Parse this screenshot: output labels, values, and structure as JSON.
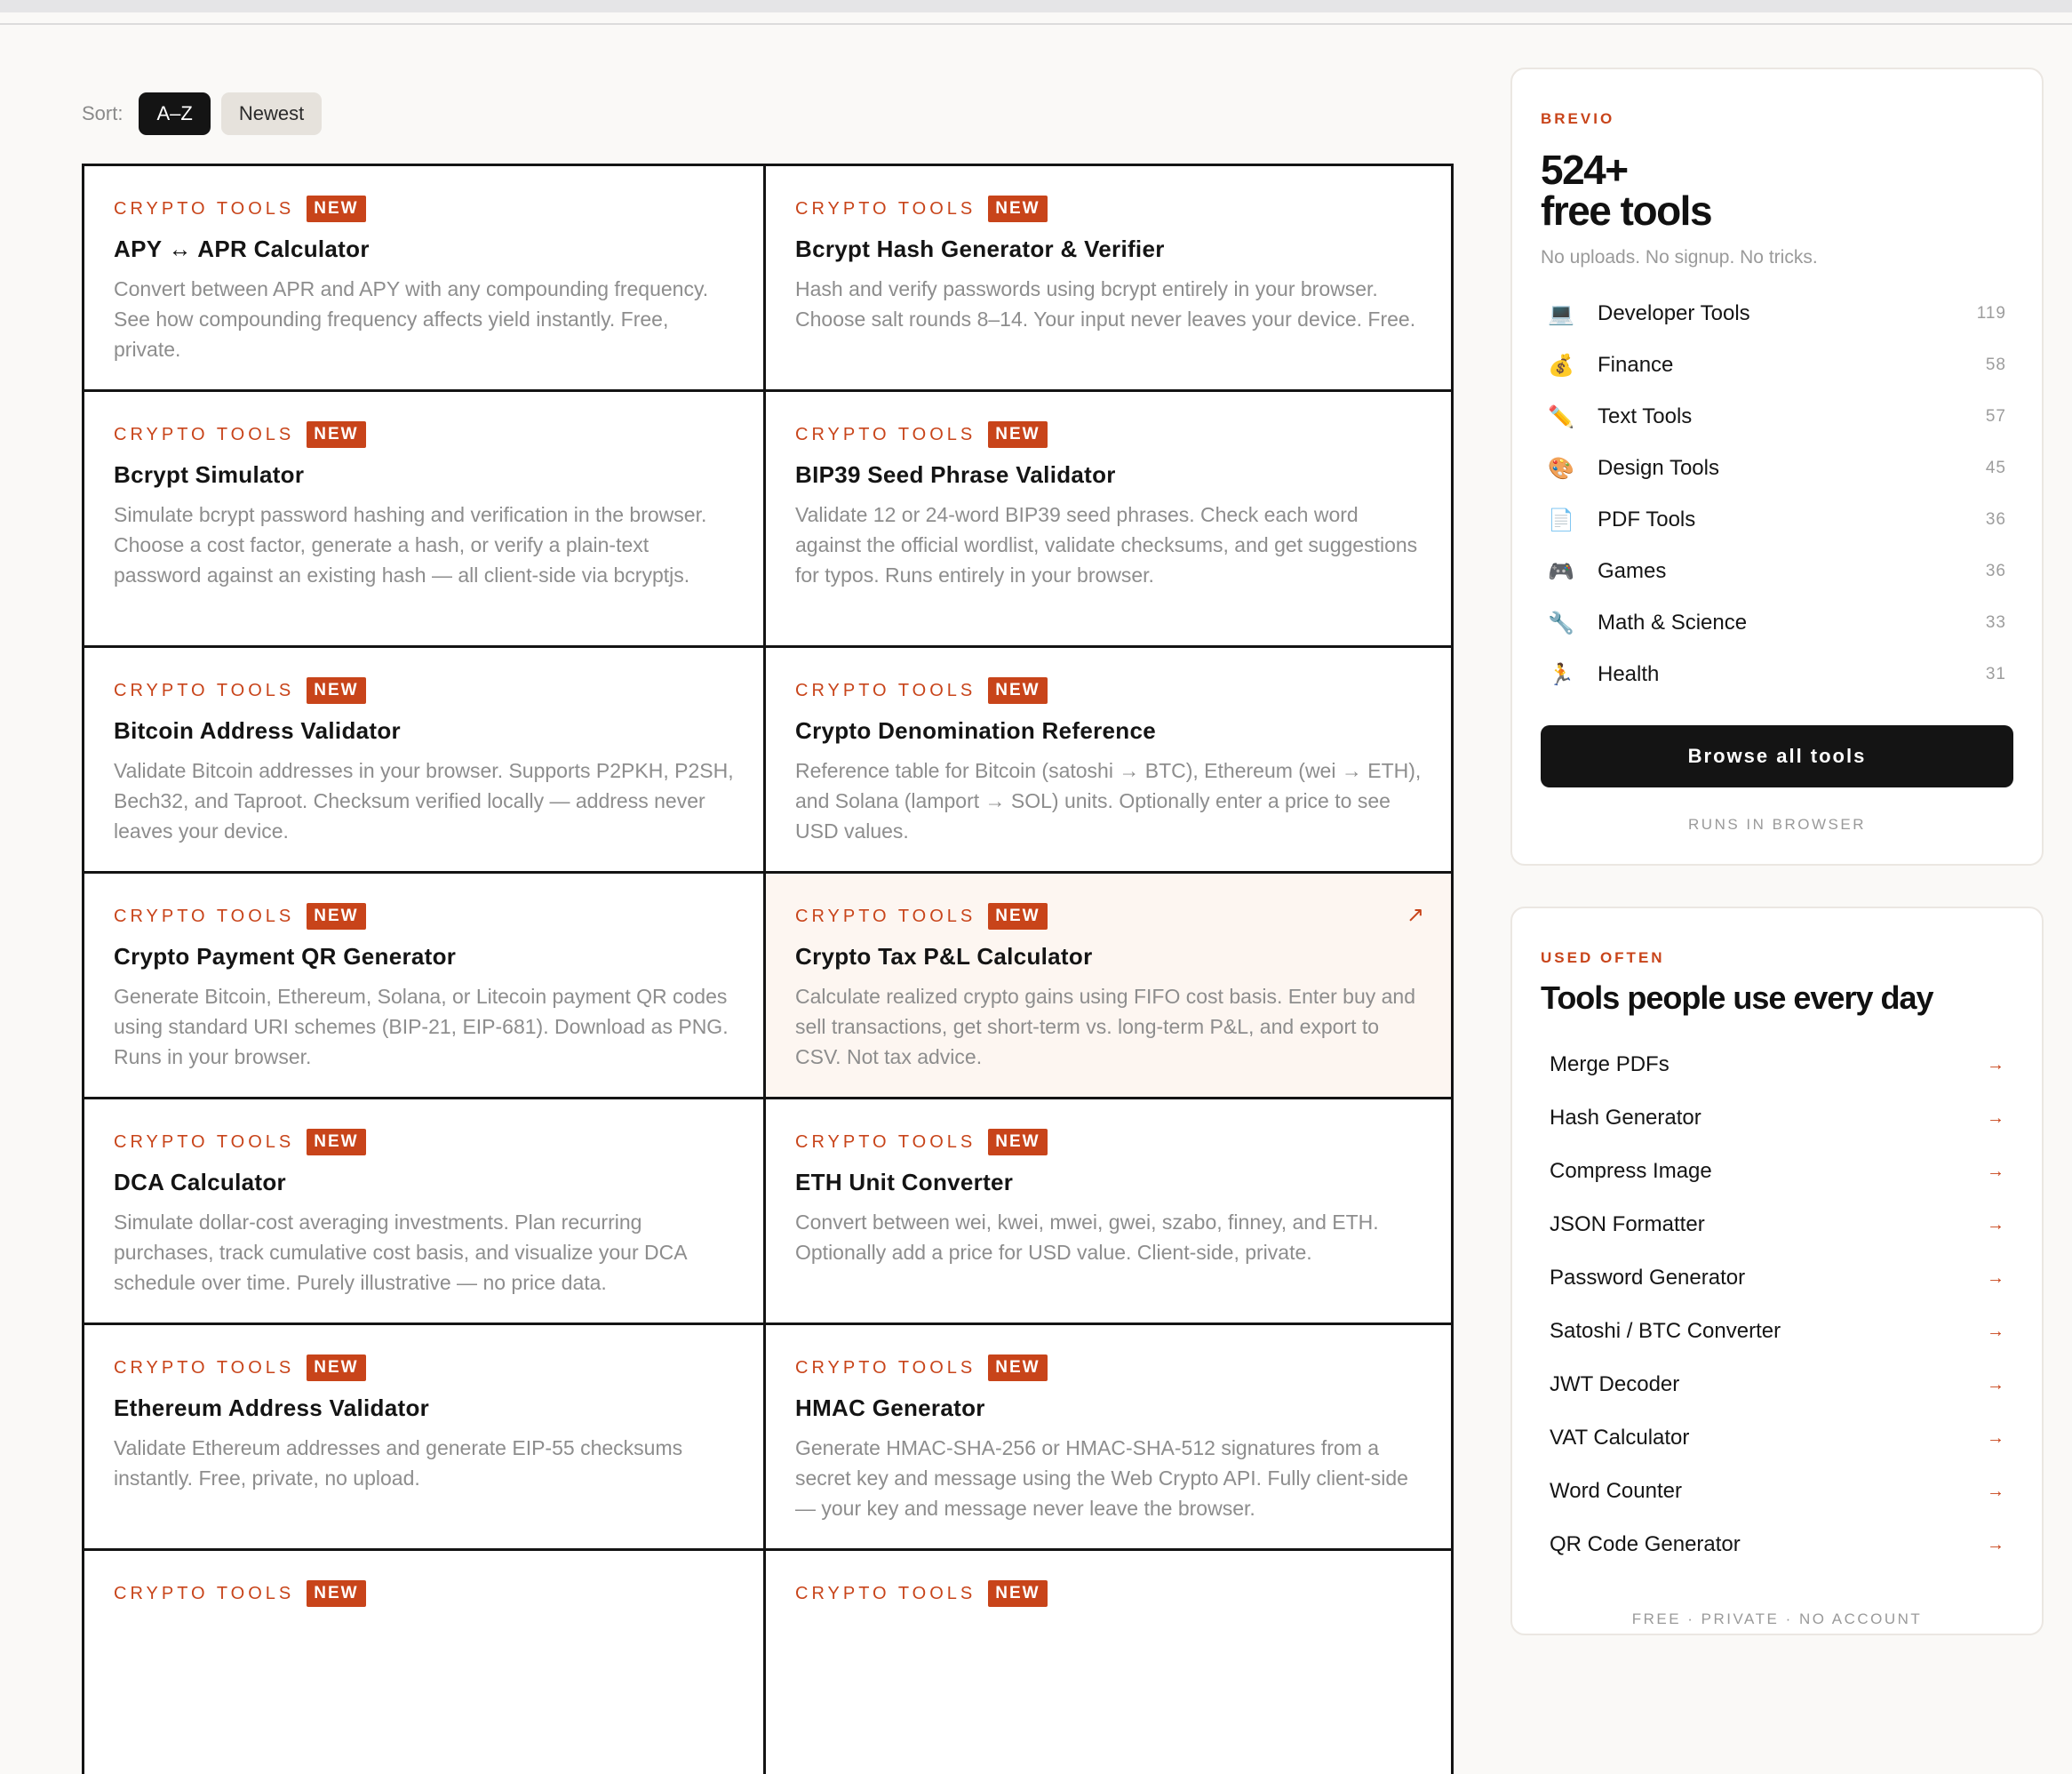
{
  "sort": {
    "label": "Sort:",
    "options": [
      "A–Z",
      "Newest"
    ]
  },
  "cards": [
    {
      "category": "CRYPTO TOOLS",
      "badge": "NEW",
      "title": "APY ↔ APR Calculator",
      "desc": "Convert between APR and APY with any compounding frequency. See how compounding frequency affects yield instantly. Free, private."
    },
    {
      "category": "CRYPTO TOOLS",
      "badge": "NEW",
      "title": "Bcrypt Hash Generator & Verifier",
      "desc": "Hash and verify passwords using bcrypt entirely in your browser. Choose salt rounds 8–14. Your input never leaves your device. Free."
    },
    {
      "category": "CRYPTO TOOLS",
      "badge": "NEW",
      "title": "Bcrypt Simulator",
      "desc": "Simulate bcrypt password hashing and verification in the browser. Choose a cost factor, generate a hash, or verify a plain-text password against an existing hash — all client-side via bcryptjs."
    },
    {
      "category": "CRYPTO TOOLS",
      "badge": "NEW",
      "title": "BIP39 Seed Phrase Validator",
      "desc": "Validate 12 or 24-word BIP39 seed phrases. Check each word against the official wordlist, validate checksums, and get suggestions for typos. Runs entirely in your browser."
    },
    {
      "category": "CRYPTO TOOLS",
      "badge": "NEW",
      "title": "Bitcoin Address Validator",
      "desc": "Validate Bitcoin addresses in your browser. Supports P2PKH, P2SH, Bech32, and Taproot. Checksum verified locally — address never leaves your device."
    },
    {
      "category": "CRYPTO TOOLS",
      "badge": "NEW",
      "title": "Crypto Denomination Reference",
      "desc": "Reference table for Bitcoin (satoshi → BTC), Ethereum (wei → ETH), and Solana (lamport → SOL) units. Optionally enter a price to see USD values."
    },
    {
      "category": "CRYPTO TOOLS",
      "badge": "NEW",
      "title": "Crypto Payment QR Generator",
      "desc": "Generate Bitcoin, Ethereum, Solana, or Litecoin payment QR codes using standard URI schemes (BIP-21, EIP-681). Download as PNG. Runs in your browser."
    },
    {
      "category": "CRYPTO TOOLS",
      "badge": "NEW",
      "title": "Crypto Tax P&L Calculator",
      "desc": "Calculate realized crypto gains using FIFO cost basis. Enter buy and sell transactions, get short-term vs. long-term P&L, and export to CSV. Not tax advice.",
      "arrow": "↗"
    },
    {
      "category": "CRYPTO TOOLS",
      "badge": "NEW",
      "title": "DCA Calculator",
      "desc": "Simulate dollar-cost averaging investments. Plan recurring purchases, track cumulative cost basis, and visualize your DCA schedule over time. Purely illustrative — no price data."
    },
    {
      "category": "CRYPTO TOOLS",
      "badge": "NEW",
      "title": "ETH Unit Converter",
      "desc": "Convert between wei, kwei, mwei, gwei, szabo, finney, and ETH. Optionally add a price for USD value. Client-side, private."
    },
    {
      "category": "CRYPTO TOOLS",
      "badge": "NEW",
      "title": "Ethereum Address Validator",
      "desc": "Validate Ethereum addresses and generate EIP-55 checksums instantly. Free, private, no upload."
    },
    {
      "category": "CRYPTO TOOLS",
      "badge": "NEW",
      "title": "HMAC Generator",
      "desc": "Generate HMAC-SHA-256 or HMAC-SHA-512 signatures from a secret key and message using the Web Crypto API. Fully client-side — your key and message never leave the browser."
    },
    {
      "category": "CRYPTO TOOLS",
      "badge": "NEW",
      "title": "",
      "desc": ""
    },
    {
      "category": "CRYPTO TOOLS",
      "badge": "NEW",
      "title": "",
      "desc": ""
    }
  ],
  "sidebar": {
    "eyebrow": "BREVIO",
    "headline_1": "524+",
    "headline_2": "free tools",
    "subtitle": "No uploads. No signup. No tricks.",
    "categories": [
      {
        "icon": "💻",
        "name": "Developer Tools",
        "count": "119"
      },
      {
        "icon": "💰",
        "name": "Finance",
        "count": "58"
      },
      {
        "icon": "✏️",
        "name": "Text Tools",
        "count": "57"
      },
      {
        "icon": "🎨",
        "name": "Design Tools",
        "count": "45"
      },
      {
        "icon": "📄",
        "name": "PDF Tools",
        "count": "36"
      },
      {
        "icon": "🎮",
        "name": "Games",
        "count": "36"
      },
      {
        "icon": "🔧",
        "name": "Math & Science",
        "count": "33"
      },
      {
        "icon": "🏃",
        "name": "Health",
        "count": "31"
      }
    ],
    "browse_label": "Browse all tools",
    "footer": "RUNS IN BROWSER"
  },
  "used": {
    "eyebrow": "USED OFTEN",
    "title": "Tools people use every day",
    "arrow": "→",
    "items": [
      "Merge PDFs",
      "Hash Generator",
      "Compress Image",
      "JSON Formatter",
      "Password Generator",
      "Satoshi / BTC Converter",
      "JWT Decoder",
      "VAT Calculator",
      "Word Counter",
      "QR Code Generator"
    ],
    "footer": "FREE · PRIVATE · NO ACCOUNT"
  },
  "colors": {
    "accent": "#c8441a",
    "dark": "#141414",
    "background": "#faf9f7"
  }
}
